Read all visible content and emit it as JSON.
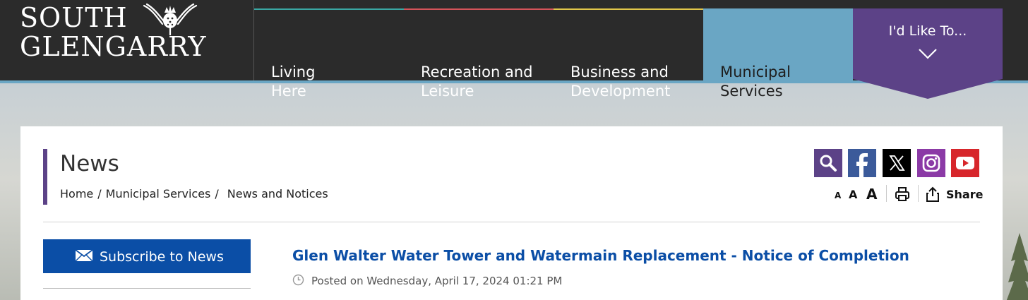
{
  "logo": {
    "line1": "SOUTH",
    "line2": "GLENGARRY",
    "emblem_icon": "thistle-icon"
  },
  "nav": {
    "items": [
      {
        "label": "Living\nHere",
        "stripe_color": "#3aa7a3"
      },
      {
        "label": "Recreation and\nLeisure",
        "stripe_color": "#d4545a"
      },
      {
        "label": "Business and\nDevelopment",
        "stripe_color": "#e1c74a"
      },
      {
        "label": "Municipal\nServices",
        "stripe_color": "#6aa6c4",
        "active": true
      }
    ],
    "id_like_to": {
      "label": "I'd Like To...",
      "icon": "chevron-down-icon"
    }
  },
  "page": {
    "title": "News",
    "breadcrumb": [
      {
        "label": "Home"
      },
      {
        "label": "Municipal Services"
      },
      {
        "label": "News and Notices",
        "current": true
      }
    ]
  },
  "tools": {
    "social": [
      {
        "name": "search-icon",
        "color": "#5c4287"
      },
      {
        "name": "facebook-icon",
        "color": "#3b5a9a"
      },
      {
        "name": "x-icon",
        "color": "#000000"
      },
      {
        "name": "instagram-icon",
        "color": "#8b3aa6"
      },
      {
        "name": "youtube-icon",
        "color": "#d7262b"
      }
    ],
    "text_size": [
      "A",
      "A",
      "A"
    ],
    "print_icon": "printer-icon",
    "share_label": "Share"
  },
  "sidebar": {
    "subscribe_label": "Subscribe to News",
    "subscribe_icon": "envelope-icon"
  },
  "article": {
    "title": "Glen Walter Water Tower and Watermain Replacement - Notice of Completion",
    "posted": "Posted on Wednesday, April 17, 2024 01:21 PM",
    "posted_icon": "clock-icon"
  },
  "colors": {
    "header_bg": "#2b2b2b",
    "accent_blue": "#6aa6c4",
    "purple": "#5c4287",
    "link_blue": "#0b4ea6"
  }
}
